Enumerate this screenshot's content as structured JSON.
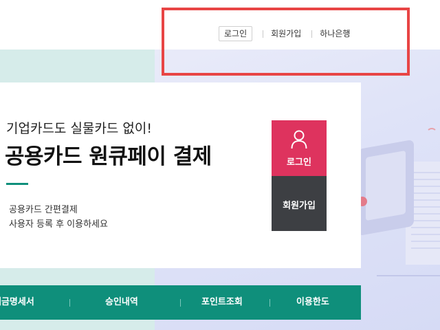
{
  "header": {
    "nav": [
      {
        "label": "로그인"
      },
      {
        "label": "회원가입"
      },
      {
        "label": "하나은행"
      }
    ]
  },
  "hero": {
    "subtitle": "기업카드도 실물카드 없이!",
    "title": "공용카드 원큐페이 결제",
    "desc_line1": "공용카드 간편결제",
    "desc_line2": "사용자 등록 후 이용하세요",
    "login_label": "로그인",
    "join_label": "회원가입"
  },
  "quick_menu": [
    {
      "label": "대금명세서"
    },
    {
      "label": "승인내역"
    },
    {
      "label": "포인트조회"
    },
    {
      "label": "이용한도"
    }
  ],
  "colors": {
    "accent_green": "#0f8f7b",
    "login_pink": "#de335e",
    "join_dark": "#3d3f43",
    "highlight_red": "#e84545"
  }
}
